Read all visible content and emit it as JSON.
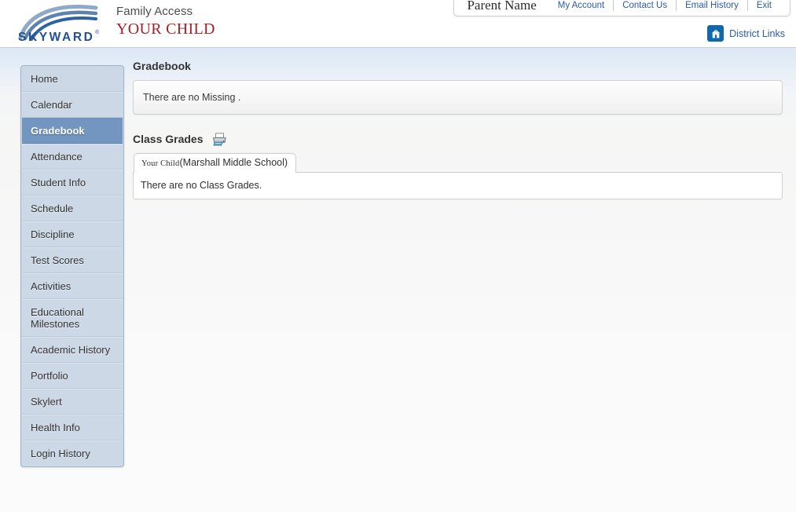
{
  "header": {
    "logo_text": "SKYWARD",
    "logo_registered": "®",
    "product_name": "Family Access",
    "student_name": "YOUR CHILD",
    "account": {
      "parent_name": "Parent Name",
      "links": [
        {
          "label": "My Account",
          "name": "my-account"
        },
        {
          "label": "Contact Us",
          "name": "contact-us"
        },
        {
          "label": "Email History",
          "name": "email-history"
        },
        {
          "label": "Exit",
          "name": "exit"
        }
      ]
    },
    "district_links": {
      "label": "District Links",
      "icon": "school-building-icon",
      "icon_color": "#1069ab"
    }
  },
  "sidebar": {
    "items": [
      {
        "label": "Home",
        "selected": false
      },
      {
        "label": "Calendar",
        "selected": false
      },
      {
        "label": "Gradebook",
        "selected": true
      },
      {
        "label": "Attendance",
        "selected": false
      },
      {
        "label": "Student Info",
        "selected": false
      },
      {
        "label": "Schedule",
        "selected": false
      },
      {
        "label": "Discipline",
        "selected": false
      },
      {
        "label": "Test Scores",
        "selected": false
      },
      {
        "label": "Activities",
        "selected": false
      },
      {
        "label": "Educational Milestones",
        "selected": false
      },
      {
        "label": "Academic History",
        "selected": false
      },
      {
        "label": "Portfolio",
        "selected": false
      },
      {
        "label": "Skylert",
        "selected": false
      },
      {
        "label": "Health Info",
        "selected": false
      },
      {
        "label": "Login History",
        "selected": false
      }
    ],
    "selected_color": "#7296bf",
    "background_color": "#ccd8e6"
  },
  "main": {
    "gradebook": {
      "title": "Gradebook",
      "message": "There are no Missing ."
    },
    "class_grades": {
      "title": "Class Grades",
      "print_icon": "printer-icon",
      "tabs": [
        {
          "student": "Your Child",
          "school": "(Marshall Middle School)",
          "active": true
        }
      ],
      "message": "There are no Class Grades."
    }
  }
}
